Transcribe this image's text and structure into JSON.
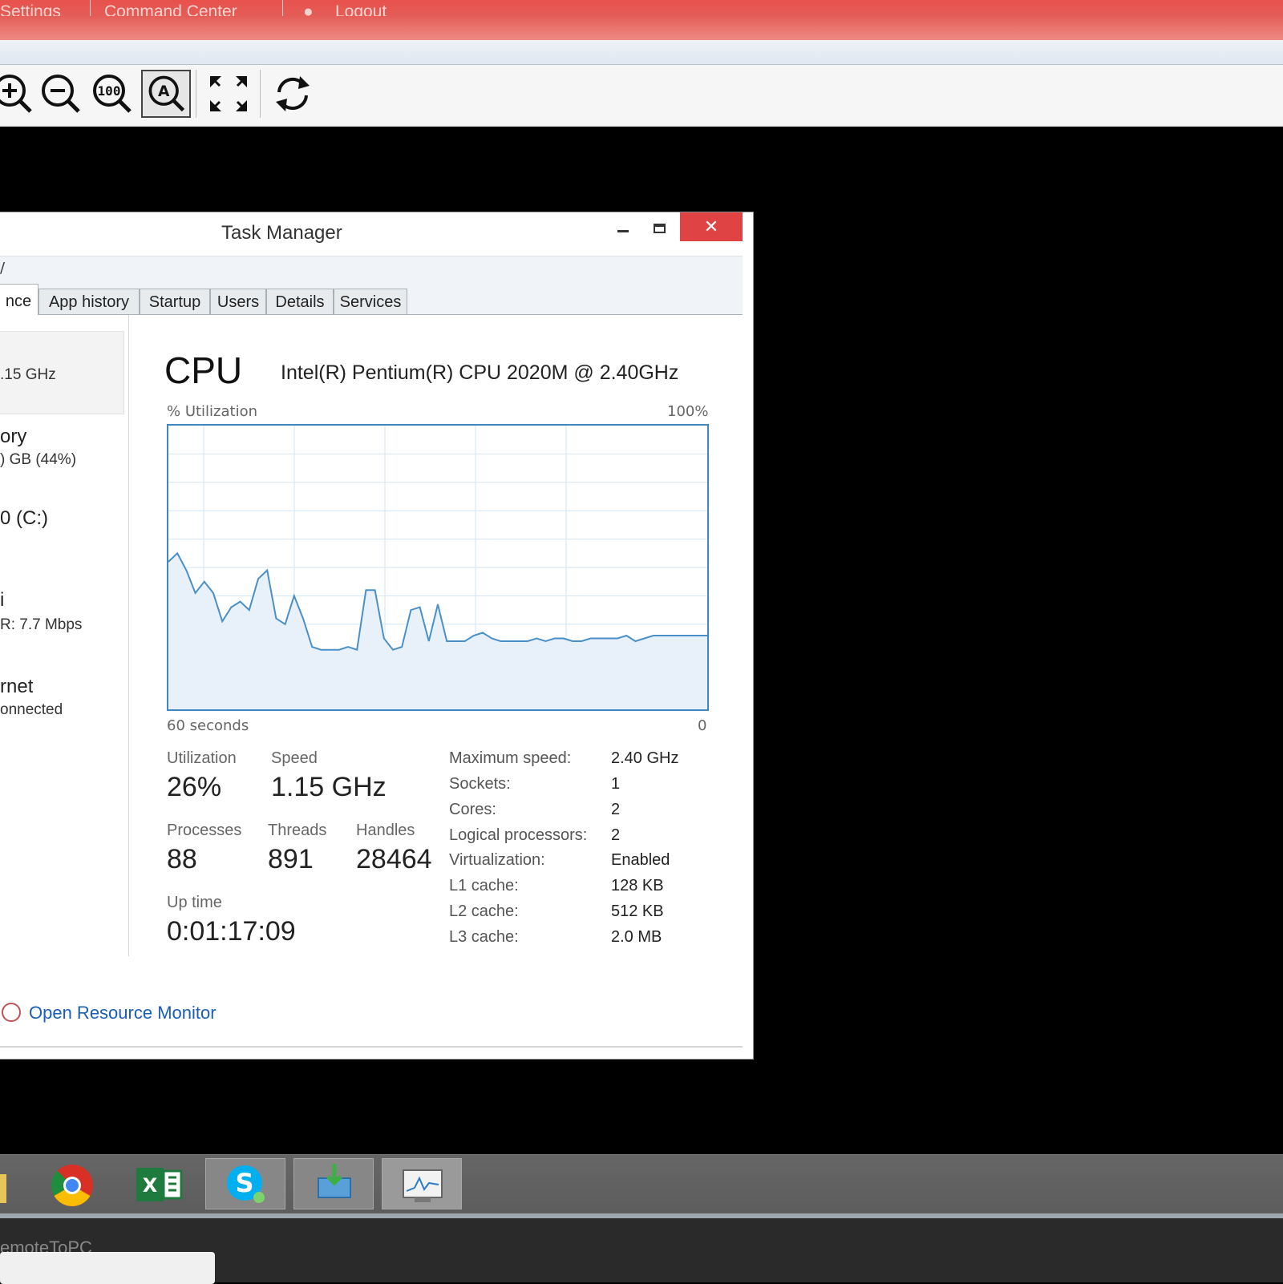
{
  "top_menu": {
    "settings": "Settings",
    "command_center": "Command Center",
    "logout": "Logout"
  },
  "toolbar": {
    "buttons": [
      "zoom-in-icon",
      "zoom-out-icon",
      "zoom-100-icon",
      "zoom-auto-icon",
      "fullscreen-icon",
      "refresh-icon"
    ],
    "active": "zoom-auto-icon"
  },
  "task_manager": {
    "title": "Task Manager",
    "close_glyph": "✕",
    "menu_partial": "/",
    "tabs": [
      "nce",
      "App history",
      "Startup",
      "Users",
      "Details",
      "Services"
    ],
    "selected_tab": "nce"
  },
  "sidebar": {
    "cpu_sub": ".15 GHz",
    "memory_title": "ory",
    "memory_sub": ") GB (44%)",
    "disk_title": "0 (C:)",
    "wifi_title": "i",
    "wifi_sub": "R: 7.7 Mbps",
    "ethernet_title": "rnet",
    "ethernet_sub": "onnected"
  },
  "cpu": {
    "heading": "CPU",
    "name": "Intel(R) Pentium(R) CPU 2020M @ 2.40GHz",
    "util_label": "% Utilization",
    "util_max": "100%",
    "time_label": "60 seconds",
    "time_end": "0",
    "utilization_label": "Utilization",
    "utilization": "26%",
    "speed_label": "Speed",
    "speed": "1.15 GHz",
    "processes_label": "Processes",
    "processes": "88",
    "threads_label": "Threads",
    "threads": "891",
    "handles_label": "Handles",
    "handles": "28464",
    "uptime_label": "Up time",
    "uptime": "0:01:17:09",
    "specs": [
      {
        "label": "Maximum speed:",
        "value": "2.40 GHz"
      },
      {
        "label": "Sockets:",
        "value": "1"
      },
      {
        "label": "Cores:",
        "value": "2"
      },
      {
        "label": "Logical processors:",
        "value": "2"
      },
      {
        "label": "Virtualization:",
        "value": "Enabled"
      },
      {
        "label": "L1 cache:",
        "value": "128 KB"
      },
      {
        "label": "L2 cache:",
        "value": "512 KB"
      },
      {
        "label": "L3 cache:",
        "value": "2.0 MB"
      }
    ]
  },
  "chart_data": {
    "type": "area",
    "series": [
      {
        "values": [
          52,
          55,
          49,
          41,
          45,
          41,
          31,
          36,
          38,
          35,
          46,
          49,
          32,
          30,
          40,
          32,
          22,
          21,
          21,
          21,
          22,
          21,
          42,
          42,
          25,
          21,
          22,
          35,
          36,
          24,
          37,
          24,
          24,
          24,
          26,
          27,
          25,
          24,
          24,
          24,
          24,
          25,
          24,
          25,
          25,
          24,
          24,
          25,
          25,
          25,
          25,
          26,
          24,
          25,
          26,
          26,
          26,
          26,
          26,
          26,
          26
        ]
      }
    ],
    "ylim": [
      0,
      100
    ],
    "grid": true,
    "line_color": "#4a90c8",
    "fill_color": "#e8f1f9"
  },
  "footer": {
    "open_resource_monitor": "Open Resource Monitor"
  },
  "taskbar": {
    "items": [
      "folder-icon",
      "chrome-icon",
      "excel-icon",
      "skype-icon",
      "remote-transfer-icon",
      "performance-monitor-icon"
    ]
  },
  "app_footer": {
    "label": "emoteToPC"
  }
}
